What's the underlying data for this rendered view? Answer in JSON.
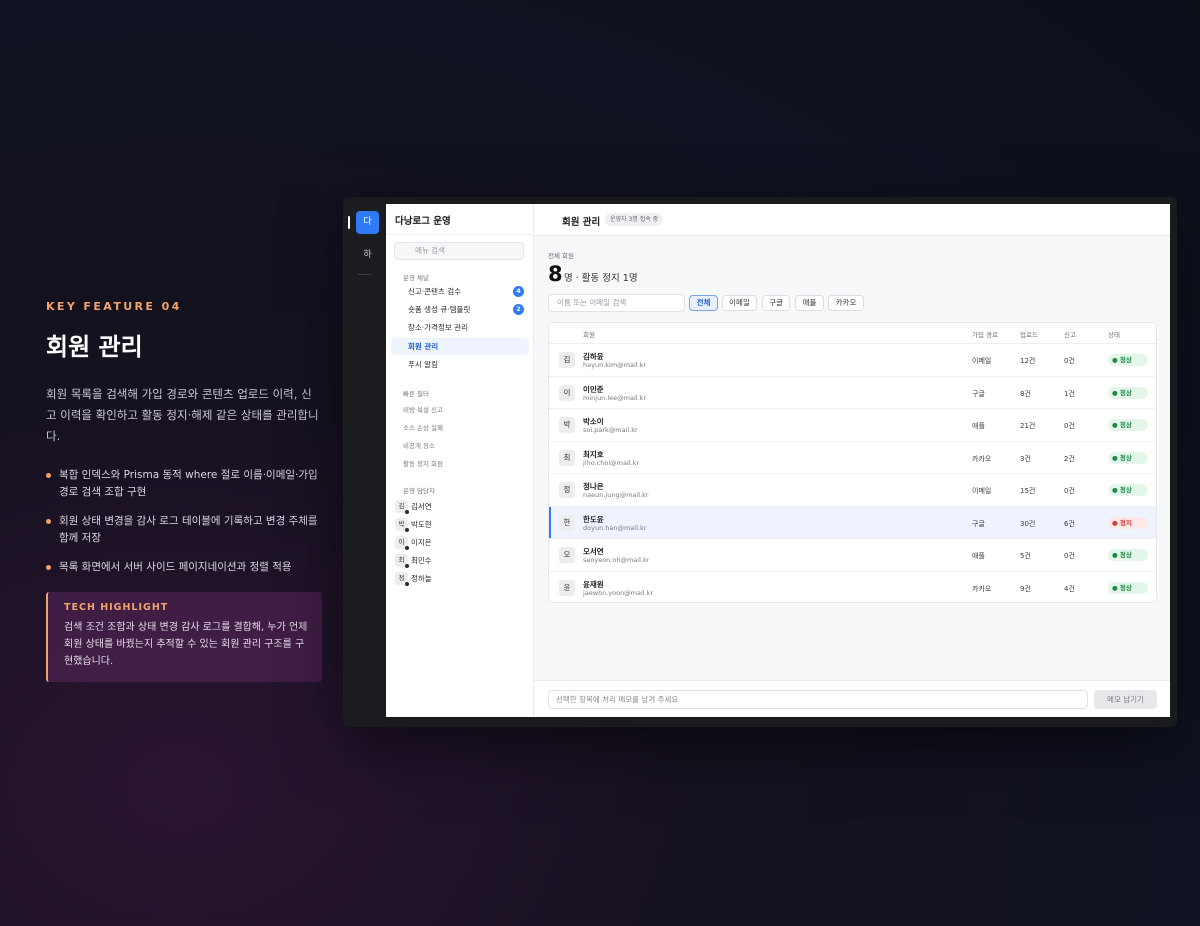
{
  "intro": {
    "eyebrow": "KEY FEATURE 04",
    "title": "회원 관리",
    "description": "회원 목록을 검색해 가입 경로와 콘텐츠 업로드 이력, 신고 이력을 확인하고 활동 정지·해제 같은 상태를 관리합니다.",
    "bullets": [
      "복합 인덱스와 Prisma 동적 where 절로 이름·이메일·가입 경로 검색 조합 구현",
      "회원 상태 변경을 감사 로그 테이블에 기록하고 변경 주체를 함께 저장",
      "목록 화면에서 서버 사이드 페이지네이션과 정렬 적용"
    ],
    "highlight": {
      "title": "TECH HIGHLIGHT",
      "text": "검색 조건 조합과 상태 변경 감사 로그를 결합해, 누가 언제 회원 상태를 바꿨는지 추적할 수 있는 회원 관리 구조를 구현했습니다."
    },
    "accent_color": "#f2a36b"
  },
  "rail": {
    "active_label": "다",
    "item_label": "하"
  },
  "sidebar": {
    "app_name": "다낭로그 운영",
    "search_placeholder": "메뉴 검색",
    "section_ops": "운영 채널",
    "items": [
      {
        "label": "신고·콘텐츠 검수",
        "badge": "4"
      },
      {
        "label": "숏폼 생성 큐·템플릿",
        "badge": "2"
      },
      {
        "label": "장소·가격정보 관리",
        "badge": ""
      },
      {
        "label": "회원 관리",
        "badge": ""
      },
      {
        "label": "푸시 알림",
        "badge": ""
      }
    ],
    "section_filters": "빠른 필터",
    "filters": [
      "비방·욕설 신고",
      "소스 손상 실패",
      "비공개 장소",
      "활동 정지 회원"
    ],
    "section_managers": "운영 담당자",
    "managers": [
      {
        "initial": "김",
        "name": "김서연"
      },
      {
        "initial": "박",
        "name": "박도현"
      },
      {
        "initial": "이",
        "name": "이지은"
      },
      {
        "initial": "최",
        "name": "최민수"
      },
      {
        "initial": "정",
        "name": "정하늘"
      }
    ]
  },
  "main": {
    "title": "회원 관리",
    "online_badge": "운영자 3명 접속 중",
    "total_label": "전체 회원",
    "total_count": "8",
    "total_sub": "명 · 활동 정지 1명",
    "search_placeholder": "이름 또는 이메일 검색",
    "chips": [
      "전체",
      "이메일",
      "구글",
      "애플",
      "카카오"
    ],
    "table": {
      "headers": {
        "member": "회원",
        "channel": "가입 경로",
        "uploads": "업로드",
        "reports": "신고",
        "status": "상태"
      },
      "rows": [
        {
          "initial": "김",
          "name": "김하윤",
          "email": "hayun.kim@mail.kr",
          "channel": "이메일",
          "uploads": "12건",
          "reports": "0건",
          "status": "● 정상",
          "state": "ok"
        },
        {
          "initial": "이",
          "name": "이민준",
          "email": "minjun.lee@mail.kr",
          "channel": "구글",
          "uploads": "8건",
          "reports": "1건",
          "status": "● 정상",
          "state": "ok"
        },
        {
          "initial": "박",
          "name": "박소이",
          "email": "soi.park@mail.kr",
          "channel": "애플",
          "uploads": "21건",
          "reports": "0건",
          "status": "● 정상",
          "state": "ok"
        },
        {
          "initial": "최",
          "name": "최지호",
          "email": "jiho.choi@mail.kr",
          "channel": "카카오",
          "uploads": "3건",
          "reports": "2건",
          "status": "● 정상",
          "state": "ok"
        },
        {
          "initial": "정",
          "name": "정나은",
          "email": "naeun.jung@mail.kr",
          "channel": "이메일",
          "uploads": "15건",
          "reports": "0건",
          "status": "● 정상",
          "state": "ok"
        },
        {
          "initial": "한",
          "name": "한도윤",
          "email": "doyun.han@mail.kr",
          "channel": "구글",
          "uploads": "30건",
          "reports": "6건",
          "status": "● 정지",
          "state": "stop"
        },
        {
          "initial": "오",
          "name": "오서연",
          "email": "seoyeon.oh@mail.kr",
          "channel": "애플",
          "uploads": "5건",
          "reports": "0건",
          "status": "● 정상",
          "state": "ok"
        },
        {
          "initial": "윤",
          "name": "윤재원",
          "email": "jaewon.yoon@mail.kr",
          "channel": "카카오",
          "uploads": "9건",
          "reports": "4건",
          "status": "● 정상",
          "state": "ok"
        }
      ]
    },
    "memo_placeholder": "선택한 항목에 처리 메모를 남겨 주세요",
    "memo_button": "메모 남기기"
  }
}
